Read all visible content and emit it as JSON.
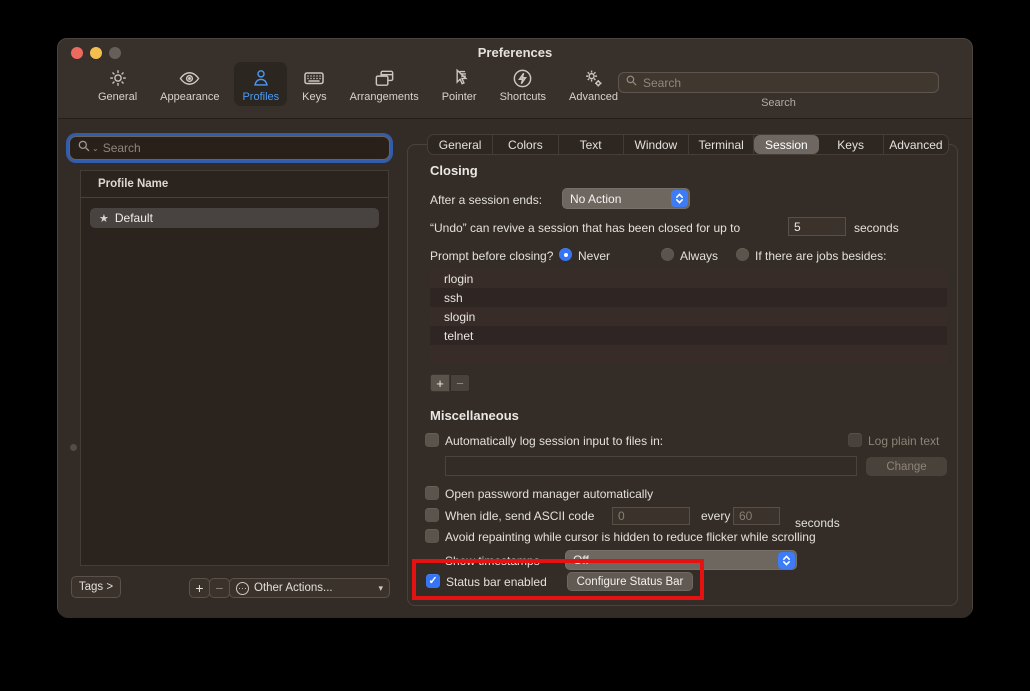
{
  "window": {
    "title": "Preferences"
  },
  "toolbar": {
    "items": [
      {
        "label": "General",
        "icon": "gear-icon"
      },
      {
        "label": "Appearance",
        "icon": "eye-icon"
      },
      {
        "label": "Profiles",
        "icon": "person-icon",
        "selected": true
      },
      {
        "label": "Keys",
        "icon": "keyboard-icon"
      },
      {
        "label": "Arrangements",
        "icon": "windows-icon"
      },
      {
        "label": "Pointer",
        "icon": "pointer-icon"
      },
      {
        "label": "Shortcuts",
        "icon": "bolt-circle-icon"
      },
      {
        "label": "Advanced",
        "icon": "gears-icon"
      }
    ],
    "search": {
      "placeholder": "Search",
      "label": "Search"
    }
  },
  "sidebar": {
    "search_placeholder": "Search",
    "list_header": "Profile Name",
    "profiles": [
      {
        "name": "Default",
        "starred": true,
        "selected": true
      }
    ],
    "tags_button": "Tags >",
    "add_button": "+",
    "remove_button": "−",
    "other_actions_button": "Other Actions..."
  },
  "tabs": {
    "items": [
      "General",
      "Colors",
      "Text",
      "Window",
      "Terminal",
      "Session",
      "Keys",
      "Advanced"
    ],
    "selected": "Session"
  },
  "session": {
    "closing": {
      "heading": "Closing",
      "after_session_label": "After a session ends:",
      "after_session_value": "No Action",
      "undo_prefix": "“Undo” can revive a session that has been closed for up to",
      "undo_value": "5",
      "undo_suffix": "seconds",
      "prompt_label": "Prompt before closing?",
      "prompt_options": [
        {
          "label": "Never",
          "selected": true
        },
        {
          "label": "Always",
          "selected": false
        },
        {
          "label": "If there are jobs besides:",
          "selected": false
        }
      ],
      "jobs": [
        "rlogin",
        "ssh",
        "slogin",
        "telnet"
      ],
      "add_job": "+",
      "remove_job": "−"
    },
    "misc": {
      "heading": "Miscellaneous",
      "auto_log_label": "Automatically log session input to files in:",
      "log_plain_text_label": "Log plain text",
      "log_dir_value": "",
      "change_button": "Change",
      "open_password_label": "Open password manager automatically",
      "idle_prefix": "When idle, send ASCII code",
      "idle_code_placeholder": "0",
      "idle_every_label": "every",
      "idle_interval_placeholder": "60",
      "idle_suffix": "seconds",
      "avoid_repaint_label": "Avoid repainting while cursor is hidden to reduce flicker while scrolling",
      "show_timestamps_label": "Show timestamps",
      "show_timestamps_value": "Off",
      "status_bar_label": "Status bar enabled",
      "configure_status_bar_button": "Configure Status Bar"
    }
  },
  "colors": {
    "accent_blue": "#3d7bf7",
    "annotation_red": "#e51212",
    "traffic_red": "#ec6a5e",
    "traffic_yellow": "#f5bf4f",
    "traffic_disabled": "#665f58"
  }
}
